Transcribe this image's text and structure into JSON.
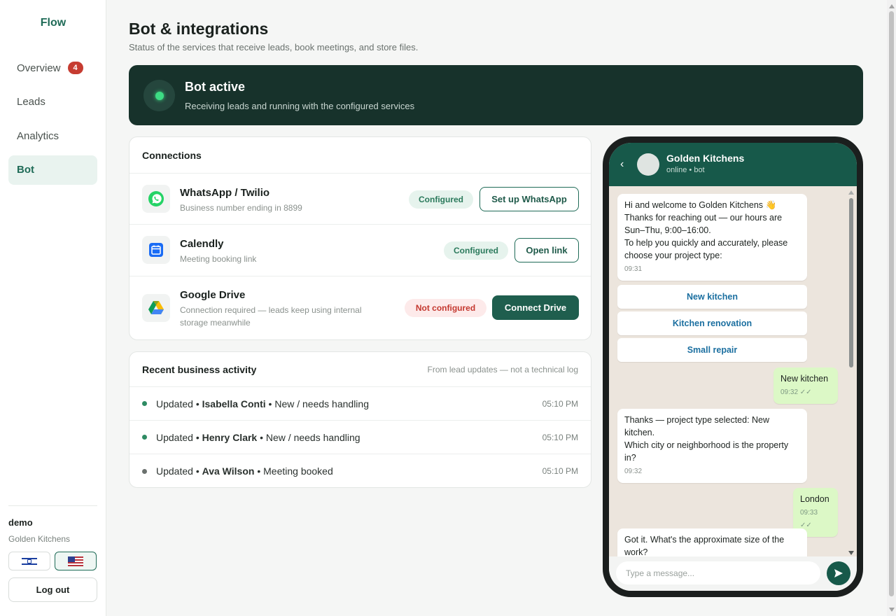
{
  "sidebar": {
    "brand": "Flow",
    "nav": [
      {
        "label": "Overview",
        "badge": "4"
      },
      {
        "label": "Leads"
      },
      {
        "label": "Analytics"
      },
      {
        "label": "Bot",
        "active": true
      }
    ],
    "user": {
      "name": "demo",
      "org": "Golden Kitchens"
    },
    "languages": [
      {
        "icon": "israel-flag-icon"
      },
      {
        "icon": "us-flag-icon",
        "active": true
      }
    ],
    "logout_label": "Log out"
  },
  "header": {
    "title": "Bot & integrations",
    "subtitle": "Status of the services that receive leads, book meetings, and store files."
  },
  "banner": {
    "title": "Bot active",
    "subtitle": "Receiving leads and running with the configured services",
    "status_color": "#3ddc84"
  },
  "connections": {
    "title": "Connections",
    "items": [
      {
        "name": "WhatsApp / Twilio",
        "desc": "Business number ending in 8899",
        "status": "Configured",
        "action": "Set up WhatsApp",
        "icon": "whatsapp-icon"
      },
      {
        "name": "Calendly",
        "desc": "Meeting booking link",
        "status": "Configured",
        "action": "Open link",
        "icon": "calendar-icon"
      },
      {
        "name": "Google Drive",
        "desc": "Connection required — leads keep using internal storage meanwhile",
        "status": "Not configured",
        "action": "Connect Drive",
        "icon": "google-drive-icon"
      }
    ]
  },
  "activity": {
    "title": "Recent business activity",
    "note": "From lead updates — not a technical log",
    "rows": [
      {
        "prefix": "Updated •",
        "name": "Isabella Conti",
        "suffix": "• New / needs handling",
        "time": "05:10 PM",
        "dot_color": "#2e8b63"
      },
      {
        "prefix": "Updated •",
        "name": "Henry Clark",
        "suffix": "• New / needs handling",
        "time": "05:10 PM",
        "dot_color": "#2e8b63"
      },
      {
        "prefix": "Updated •",
        "name": "Ava Wilson",
        "suffix": "• Meeting booked",
        "time": "05:10 PM",
        "dot_color": "#6b716e"
      }
    ]
  },
  "chat": {
    "contact": "Golden Kitchens",
    "status": "online • bot",
    "messages": [
      {
        "dir": "in",
        "lines": [
          "Hi and welcome to Golden Kitchens 👋",
          "Thanks for reaching out — our hours are",
          "Sun–Thu, 9:00–16:00.",
          "To help you quickly and accurately, please",
          "choose your project type:"
        ],
        "time": "09:31"
      },
      {
        "dir": "out",
        "lines": [
          "New kitchen"
        ],
        "time": "09:32 ✓✓"
      },
      {
        "dir": "in",
        "lines": [
          "Thanks — project type selected: New",
          "kitchen.",
          "Which city or neighborhood is the property",
          "in?"
        ],
        "time": "09:32"
      },
      {
        "dir": "out",
        "lines": [
          "London"
        ],
        "time": "09:33 ✓✓"
      },
      {
        "dir": "in",
        "lines": [
          "Got it. What's the approximate size of the",
          "work?"
        ],
        "time": ""
      }
    ],
    "choices": [
      "New kitchen",
      "Kitchen renovation",
      "Small repair"
    ],
    "input_placeholder": "Type a message..."
  }
}
